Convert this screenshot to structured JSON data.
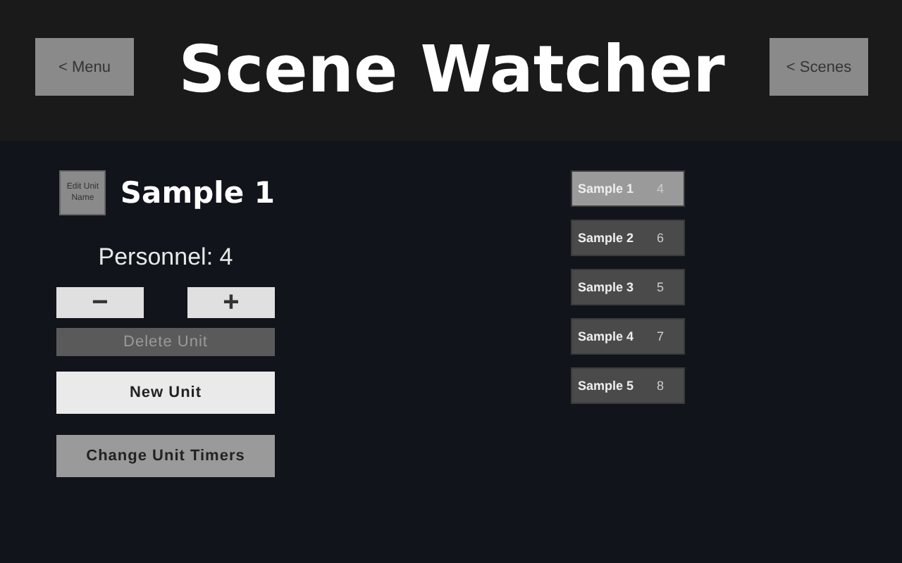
{
  "header": {
    "menu_button": "< Menu",
    "title": "Scene Watcher",
    "scenes_button": "< Scenes"
  },
  "unit": {
    "edit_button": "Edit Unit Name",
    "name": "Sample 1",
    "personnel": "Personnel: 4",
    "decrement": "−",
    "increment": "+"
  },
  "actions": [
    {
      "label": "Delete Unit",
      "kind": "delete",
      "disabled": true
    },
    {
      "label": "New Unit",
      "kind": "new",
      "disabled": false
    },
    {
      "label": "Change Unit Timers",
      "kind": "timers",
      "disabled": false
    }
  ],
  "units": [
    {
      "name": "Sample 1",
      "count": "4",
      "selected": true
    },
    {
      "name": "Sample 2",
      "count": "6",
      "selected": false
    },
    {
      "name": "Sample 3",
      "count": "5",
      "selected": false
    },
    {
      "name": "Sample 4",
      "count": "7",
      "selected": false
    },
    {
      "name": "Sample 5",
      "count": "8",
      "selected": false
    }
  ]
}
